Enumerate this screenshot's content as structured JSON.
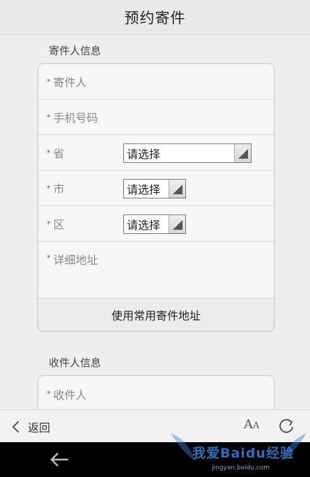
{
  "header": {
    "title": "预约寄件"
  },
  "sender": {
    "section_title": "寄件人信息",
    "name_placeholder": "寄件人",
    "phone_placeholder": "手机号码",
    "province_label": "省",
    "province_value": "请选择",
    "city_label": "市",
    "city_value": "请选择",
    "district_label": "区",
    "district_value": "请选择",
    "address_placeholder": "详细地址",
    "use_common_address_label": "使用常用寄件地址"
  },
  "receiver": {
    "section_title": "收件人信息",
    "name_placeholder": "收件人"
  },
  "required_mark": "*",
  "browser": {
    "back_label": "返回",
    "font_label_big": "A",
    "font_label_small": "A"
  },
  "watermark": {
    "text": "我爱Baidu经验",
    "url": "jingyan.baidu.com"
  },
  "colors": {
    "required": "#c0392b",
    "watermark": "#3b7fd6"
  }
}
